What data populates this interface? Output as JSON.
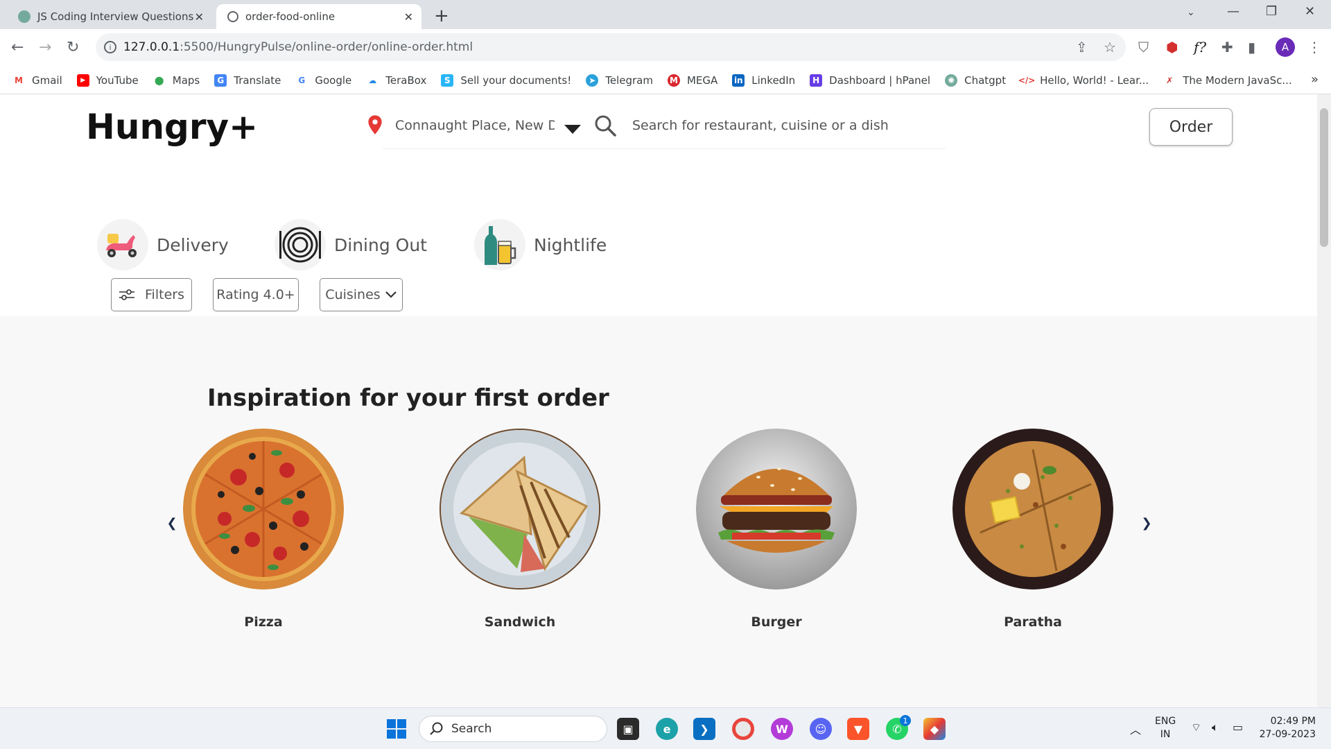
{
  "browser": {
    "tabs": [
      {
        "title": "JS Coding Interview Questions",
        "active": false
      },
      {
        "title": "order-food-online",
        "active": true
      }
    ],
    "url_host": "127.0.0.1",
    "url_path": ":5500/HungryPulse/online-order/online-order.html",
    "avatar_letter": "A",
    "bookmarks": [
      "Gmail",
      "YouTube",
      "Maps",
      "Translate",
      "Google",
      "TeraBox",
      "Sell your documents!",
      "Telegram",
      "MEGA",
      "LinkedIn",
      "Dashboard | hPanel",
      "Chatgpt",
      "Hello, World! - Lear...",
      "The Modern JavaSc..."
    ]
  },
  "header": {
    "brand": "Hungry+",
    "location": "Connaught Place, New Delhi",
    "search_placeholder": "Search for restaurant, cuisine or a dish",
    "order_label": "Order"
  },
  "categories": [
    {
      "label": "Delivery",
      "icon": "scooter-icon"
    },
    {
      "label": "Dining Out",
      "icon": "plate-icon"
    },
    {
      "label": "Nightlife",
      "icon": "drinks-icon"
    }
  ],
  "filters": {
    "filters_label": "Filters",
    "rating_label": "Rating 4.0+",
    "cuisines_label": "Cuisines"
  },
  "inspiration": {
    "title": "Inspiration for your first order",
    "items": [
      "Pizza",
      "Sandwich",
      "Burger",
      "Paratha"
    ]
  },
  "taskbar": {
    "search_label": "Search",
    "lang": "ENG",
    "region": "IN",
    "time": "02:49 PM",
    "date": "27-09-2023",
    "whatsapp_badge": "1"
  },
  "colors": {
    "accent_red": "#e53935",
    "tab_bg": "#dee1e6",
    "section_bg": "#f8f8f8"
  }
}
